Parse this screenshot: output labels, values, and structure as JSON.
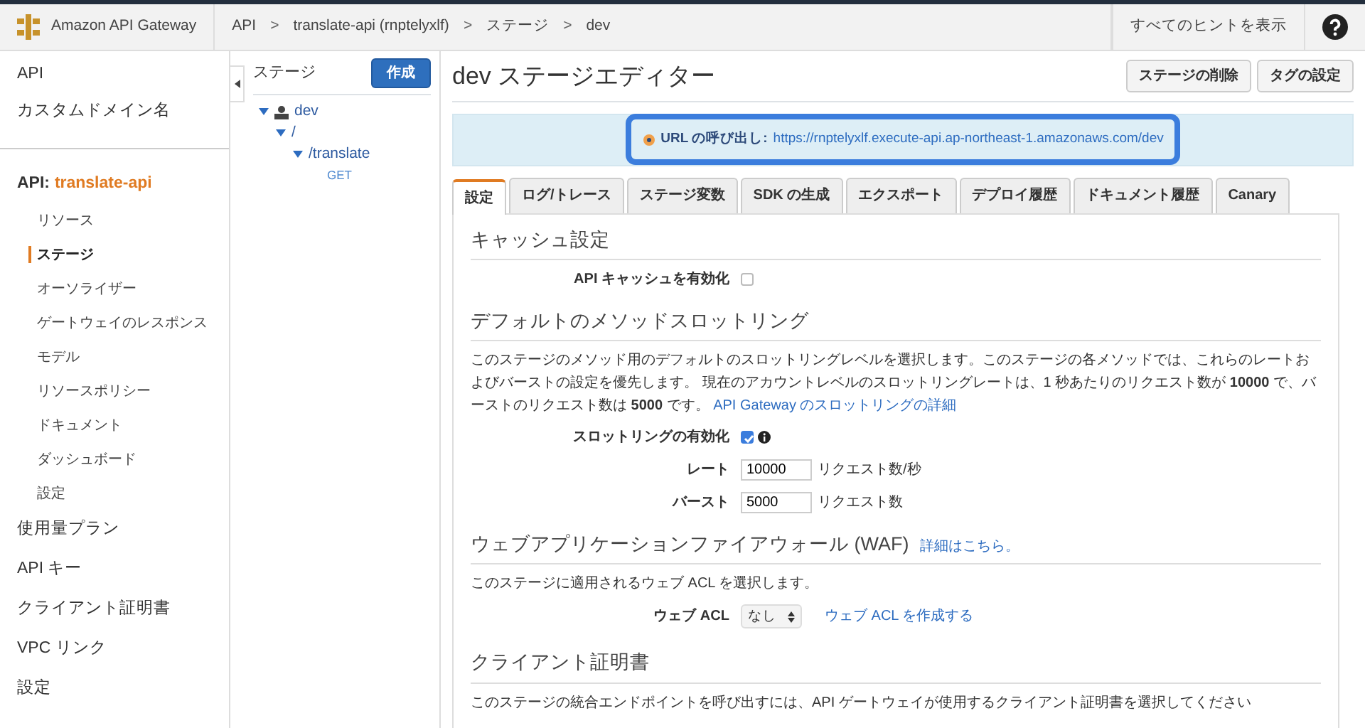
{
  "header": {
    "brand": "Amazon API Gateway",
    "breadcrumbs": [
      "API",
      "translate-api (rnptelyxlf)",
      "ステージ",
      "dev"
    ],
    "separator": ">",
    "hints_button": "すべてのヒントを表示"
  },
  "sidebar": {
    "top_items": [
      "API",
      "カスタムドメイン名"
    ],
    "api_label": "API:",
    "api_name": "translate-api",
    "sub_items": [
      {
        "label": "リソース",
        "selected": false
      },
      {
        "label": "ステージ",
        "selected": true
      },
      {
        "label": "オーソライザー",
        "selected": false
      },
      {
        "label": "ゲートウェイのレスポンス",
        "selected": false
      },
      {
        "label": "モデル",
        "selected": false
      },
      {
        "label": "リソースポリシー",
        "selected": false
      },
      {
        "label": "ドキュメント",
        "selected": false
      },
      {
        "label": "ダッシュボード",
        "selected": false
      },
      {
        "label": "設定",
        "selected": false
      }
    ],
    "bottom_items": [
      "使用量プラン",
      "API キー",
      "クライアント証明書",
      "VPC リンク",
      "設定"
    ]
  },
  "stages_panel": {
    "title": "ステージ",
    "create_button": "作成",
    "tree": [
      {
        "label": "dev",
        "kind": "stage",
        "expanded": true,
        "children": [
          {
            "label": "/",
            "kind": "resource",
            "expanded": true,
            "children": [
              {
                "label": "/translate",
                "kind": "resource",
                "expanded": true,
                "children": [
                  {
                    "label": "GET",
                    "kind": "method"
                  }
                ]
              }
            ]
          }
        ]
      }
    ]
  },
  "editor": {
    "title": "dev ステージエディター",
    "buttons": [
      "ステージの削除",
      "タグの設定"
    ],
    "invoke_label": "URL の呼び出し:",
    "invoke_url": "https://rnptelyxlf.execute-api.ap-northeast-1.amazonaws.com/dev",
    "tabs": [
      {
        "label": "設定",
        "selected": true
      },
      {
        "label": "ログ/トレース",
        "selected": false
      },
      {
        "label": "ステージ変数",
        "selected": false
      },
      {
        "label": "SDK の生成",
        "selected": false
      },
      {
        "label": "エクスポート",
        "selected": false
      },
      {
        "label": "デプロイ履歴",
        "selected": false
      },
      {
        "label": "ドキュメント履歴",
        "selected": false
      },
      {
        "label": "Canary",
        "selected": false
      }
    ],
    "cache": {
      "heading": "キャッシュ設定",
      "label": "API キャッシュを有効化",
      "checked": false
    },
    "throttling": {
      "heading": "デフォルトのメソッドスロットリング",
      "description": "このステージのメソッド用のデフォルトのスロットリングレベルを選択します。このステージの各メソッドでは、これらのレートおよびバーストの設定を優先します。 現在のアカウントレベルのスロットリングレートは、1 秒あたりのリクエスト数が **10000** で、バーストのリクエスト数は **5000** です。",
      "link": "API Gateway のスロットリングの詳細",
      "enable_label": "スロットリングの有効化",
      "enabled": true,
      "fields": [
        {
          "label": "レート",
          "value": "10000",
          "unit": "リクエスト数/秒"
        },
        {
          "label": "バースト",
          "value": "5000",
          "unit": "リクエスト数"
        }
      ]
    },
    "waf": {
      "heading": "ウェブアプリケーションファイアウォール (WAF)",
      "link": "詳細はこちら。",
      "description": "このステージに適用されるウェブ ACL を選択します。",
      "acl_label": "ウェブ ACL",
      "acl_value": "なし",
      "create_link": "ウェブ ACL を作成する"
    },
    "client_cert": {
      "heading": "クライアント証明書",
      "description": "このステージの統合エンドポイントを呼び出すには、API ゲートウェイが使用するクライアント証明書を選択してください"
    }
  }
}
